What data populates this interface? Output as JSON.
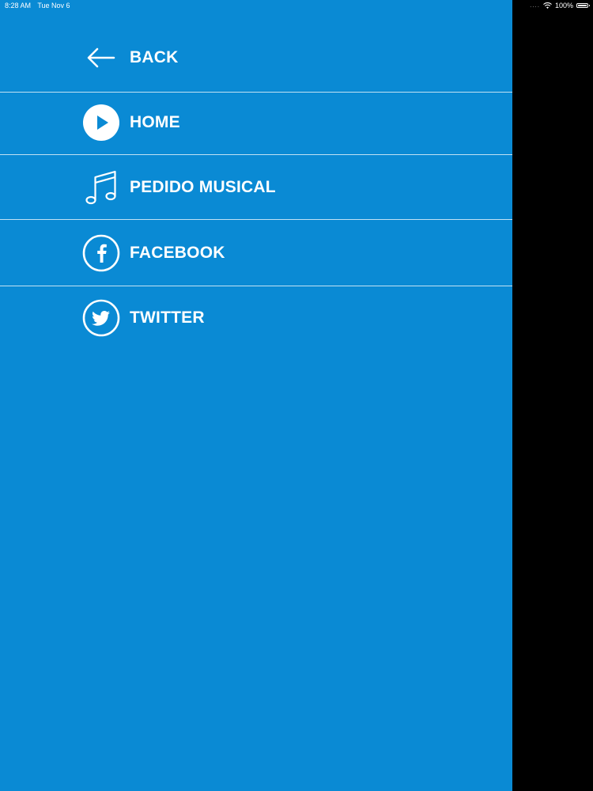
{
  "status_bar": {
    "time": "8:28 AM",
    "date": "Tue Nov 6",
    "signal": "....",
    "battery": "100%"
  },
  "colors": {
    "drawer_background": "#0a8ad4",
    "text": "#ffffff",
    "side_area": "#000000"
  },
  "menu": {
    "items": [
      {
        "label": "BACK",
        "icon": "arrow-left-icon"
      },
      {
        "label": "HOME",
        "icon": "play-circle-icon"
      },
      {
        "label": "PEDIDO MUSICAL",
        "icon": "music-note-icon"
      },
      {
        "label": "FACEBOOK",
        "icon": "facebook-icon"
      },
      {
        "label": "TWITTER",
        "icon": "twitter-icon"
      }
    ]
  }
}
